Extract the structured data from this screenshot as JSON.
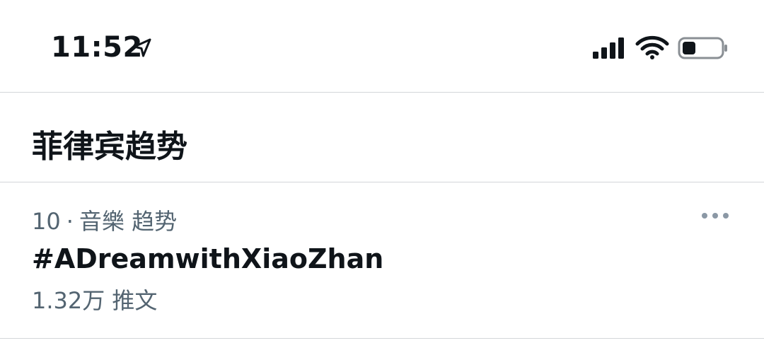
{
  "status_bar": {
    "time": "11:52",
    "location_icon": "location-arrow-icon",
    "signal_icon": "cellular-signal-icon",
    "wifi_icon": "wifi-icon",
    "battery_icon": "battery-icon",
    "battery_level": 0.35
  },
  "header": {
    "title": "菲律宾趋势"
  },
  "trend": {
    "rank": "10",
    "separator": "·",
    "category": "音樂 趋势",
    "name": "#ADreamwithXiaoZhan",
    "count": "1.32万 推文",
    "more_icon": "more-horizontal-icon"
  },
  "colors": {
    "text_primary": "#0f1419",
    "text_secondary": "#536471",
    "divider": "#d3d6d9",
    "background": "#ffffff"
  }
}
